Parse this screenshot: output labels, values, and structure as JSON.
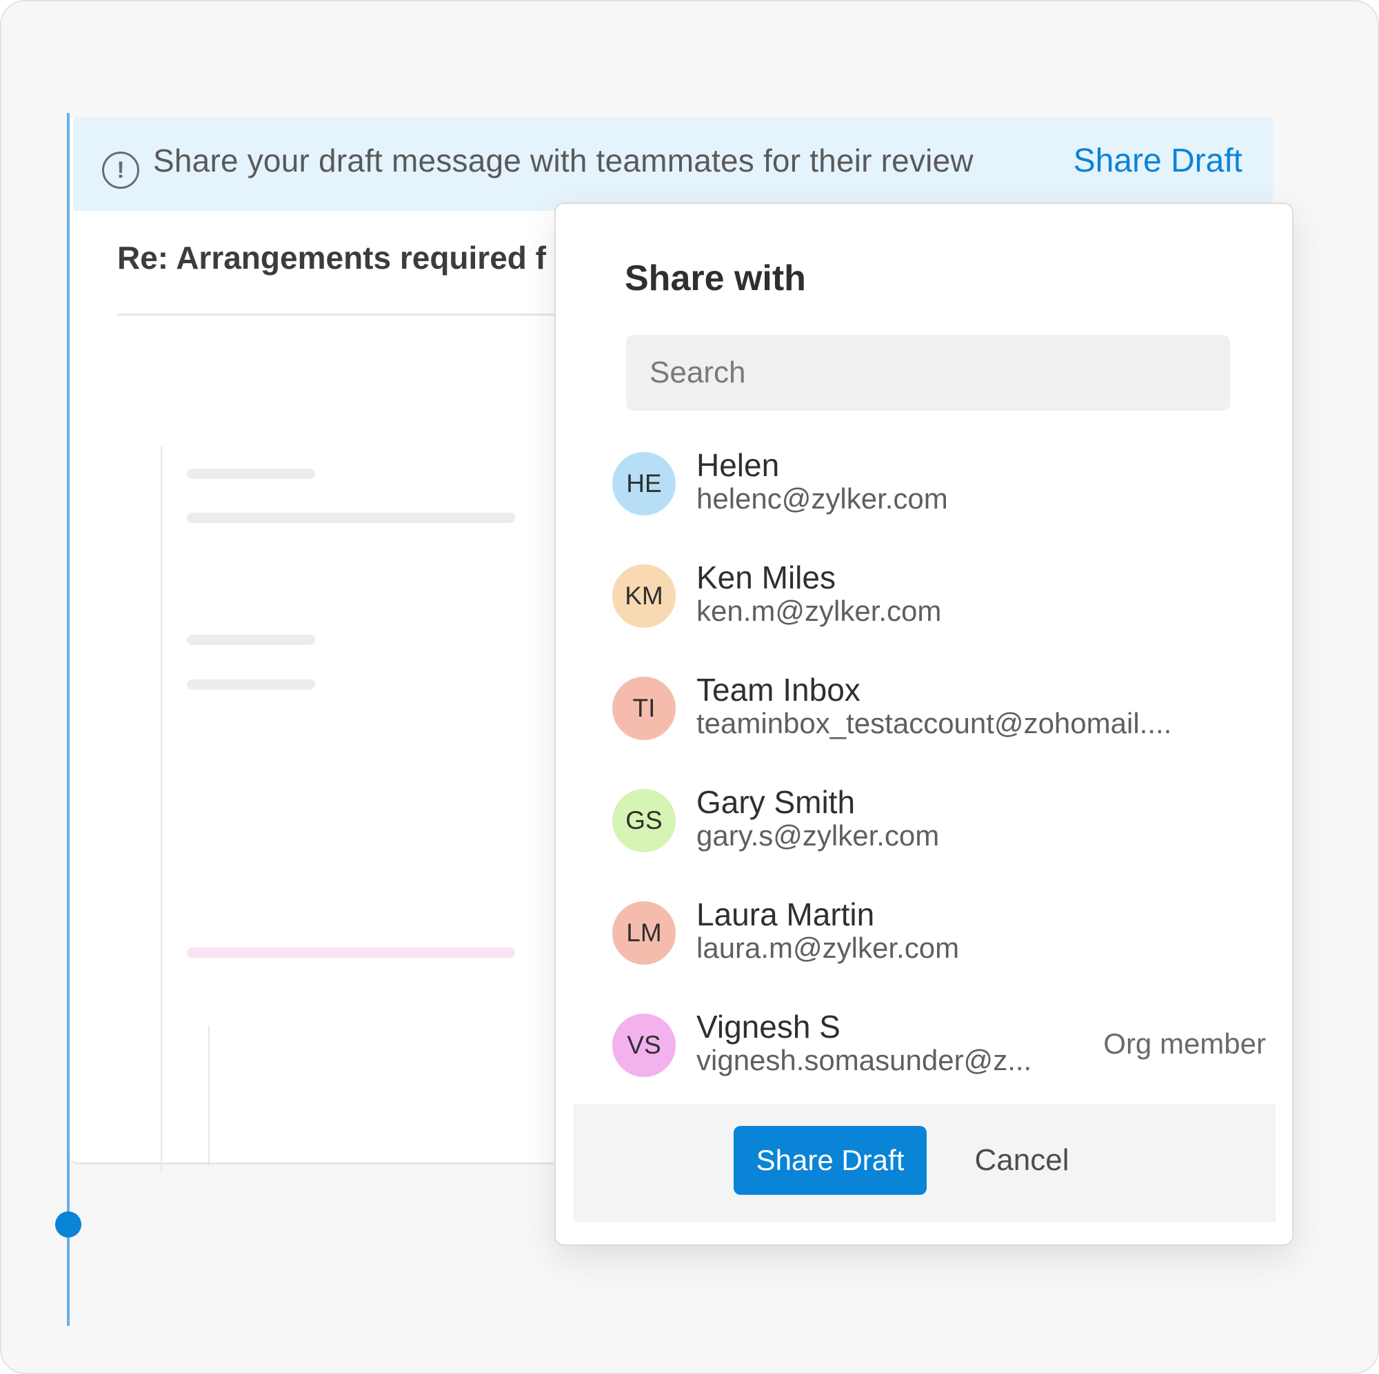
{
  "banner": {
    "icon": "info-icon",
    "message": "Share your draft message with teammates for their review",
    "link_label": "Share Draft"
  },
  "mail": {
    "subject": "Re: Arrangements required f"
  },
  "share_popup": {
    "title": "Share with",
    "search_placeholder": "Search",
    "contacts": [
      {
        "initials": "HE",
        "name": "Helen",
        "email": "helenc@zylker.com",
        "tag": "",
        "avatar_color": "#b6dff5"
      },
      {
        "initials": "KM",
        "name": "Ken Miles",
        "email": "ken.m@zylker.com",
        "tag": "",
        "avatar_color": "#f8d9b2"
      },
      {
        "initials": "TI",
        "name": "Team Inbox",
        "email": "teaminbox_testaccount@zohomail....",
        "tag": "",
        "avatar_color": "#f5bcad"
      },
      {
        "initials": "GS",
        "name": "Gary Smith",
        "email": "gary.s@zylker.com",
        "tag": "",
        "avatar_color": "#d6f4b3"
      },
      {
        "initials": "LM",
        "name": "Laura Martin",
        "email": "laura.m@zylker.com",
        "tag": "",
        "avatar_color": "#f5bcad"
      },
      {
        "initials": "VS",
        "name": "Vignesh S",
        "email": "vignesh.somasunder@z...",
        "tag": "Org member",
        "avatar_color": "#f3b1ee"
      }
    ],
    "primary_button": "Share Draft",
    "cancel_button": "Cancel"
  },
  "colors": {
    "accent": "#0a84d6",
    "banner_bg": "#e5f3fc",
    "timeline": "#6aaee6"
  }
}
